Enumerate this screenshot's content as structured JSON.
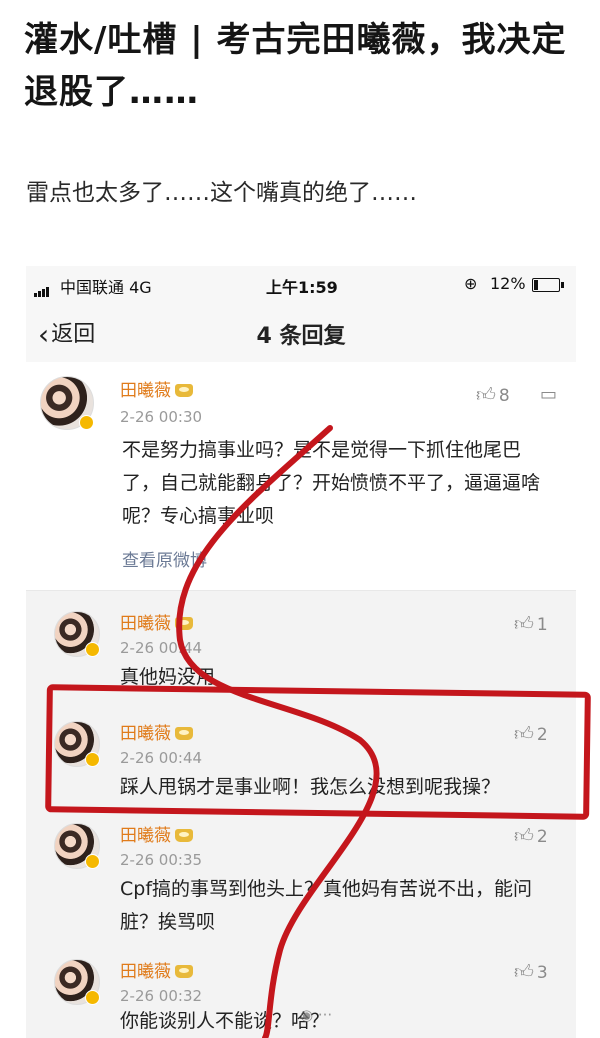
{
  "post": {
    "title": "灌水/吐槽 | 考古完田曦薇，我决定退股了……",
    "subtitle": "雷点也太多了……这个嘴真的绝了……"
  },
  "status_bar": {
    "carrier": "中国联通 4G",
    "time": "上午1:59",
    "battery": "12%"
  },
  "nav": {
    "back_label": "返回",
    "title": "4 条回复"
  },
  "main_comment": {
    "user": "田曦薇",
    "time": "2-26 00:30",
    "likes": "8",
    "text": "不是努力搞事业吗？是不是觉得一下抓住他尾巴了，自己就能翻身了？开始愤愤不平了，逼逼逼啥呢？专心搞事业呗",
    "view_original": "查看原微博"
  },
  "replies": [
    {
      "user": "田曦薇",
      "time": "2-26 00:44",
      "likes": "1",
      "text": "真他妈没用"
    },
    {
      "user": "田曦薇",
      "time": "2-26 00:44",
      "likes": "2",
      "text": "踩人甩锅才是事业啊！我怎么没想到呢我操？"
    },
    {
      "user": "田曦薇",
      "time": "2-26 00:35",
      "likes": "2",
      "text": "Cpf搞的事骂到他头上？真他妈有苦说不出，能问脏？挨骂呗"
    },
    {
      "user": "田曦薇",
      "time": "2-26 00:32",
      "likes": "3",
      "text": "你能谈别人不能谈？哈？"
    }
  ],
  "icons": {
    "thumb": "thumb-up-icon",
    "reply": "comment-icon",
    "back": "chevron-left-icon",
    "badge": "crown-badge-icon"
  },
  "colors": {
    "username": "#e07b1a",
    "annotation_red": "#c4161c"
  }
}
